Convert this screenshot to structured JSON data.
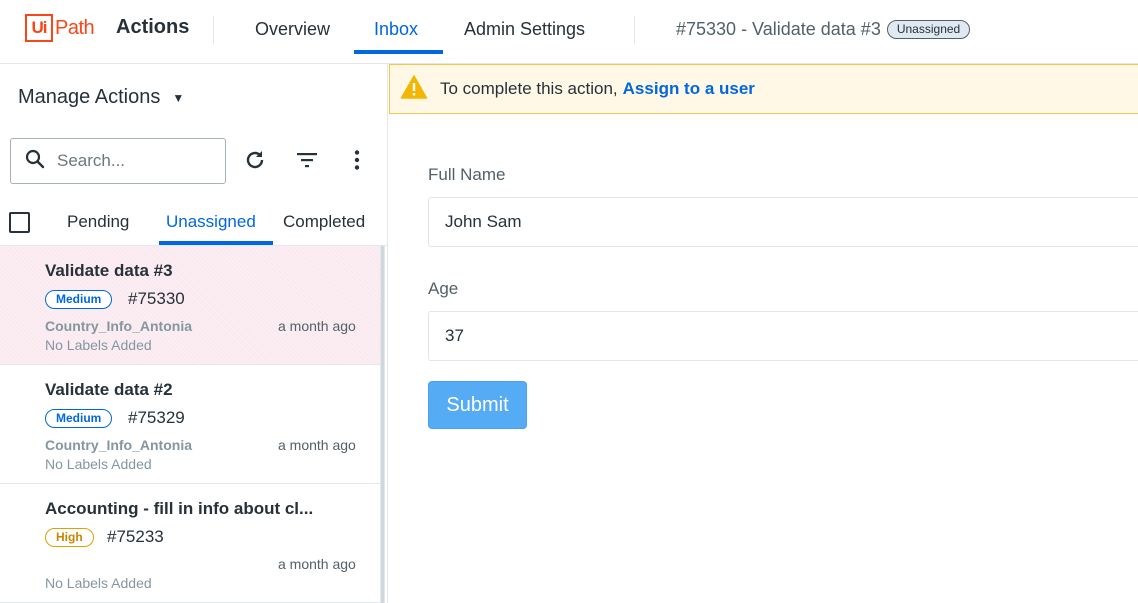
{
  "header": {
    "logo_ui": "Ui",
    "logo_path": "Path",
    "app_title": "Actions",
    "nav": [
      "Overview",
      "Inbox",
      "Admin Settings"
    ],
    "active_nav": "Inbox",
    "breadcrumb": "#75330 - Validate data #3",
    "status_badge": "Unassigned"
  },
  "sidebar": {
    "manage_label": "Manage Actions",
    "search_placeholder": "Search...",
    "tabs": [
      "Pending",
      "Unassigned",
      "Completed"
    ],
    "active_tab": "Unassigned",
    "items": [
      {
        "title": "Validate data #3",
        "priority": "Medium",
        "id": "#75330",
        "process": "Country_Info_Antonia",
        "time": "a month ago",
        "labels": "No Labels Added",
        "selected": true
      },
      {
        "title": "Validate data #2",
        "priority": "Medium",
        "id": "#75329",
        "process": "Country_Info_Antonia",
        "time": "a month ago",
        "labels": "No Labels Added",
        "selected": false
      },
      {
        "title": "Accounting - fill in info about cl...",
        "priority": "High",
        "id": "#75233",
        "process": "",
        "time": "a month ago",
        "labels": "No Labels Added",
        "selected": false
      }
    ]
  },
  "banner": {
    "text": "To complete this action,",
    "link": "Assign to a user"
  },
  "form": {
    "full_name_label": "Full Name",
    "full_name_value": "John Sam",
    "age_label": "Age",
    "age_value": "37",
    "submit_label": "Submit"
  },
  "colors": {
    "accent": "#0067df",
    "brand": "#fa4616",
    "warning": "#f2c84b",
    "submit": "#55acf5",
    "selected_row": "#fae9ef"
  }
}
